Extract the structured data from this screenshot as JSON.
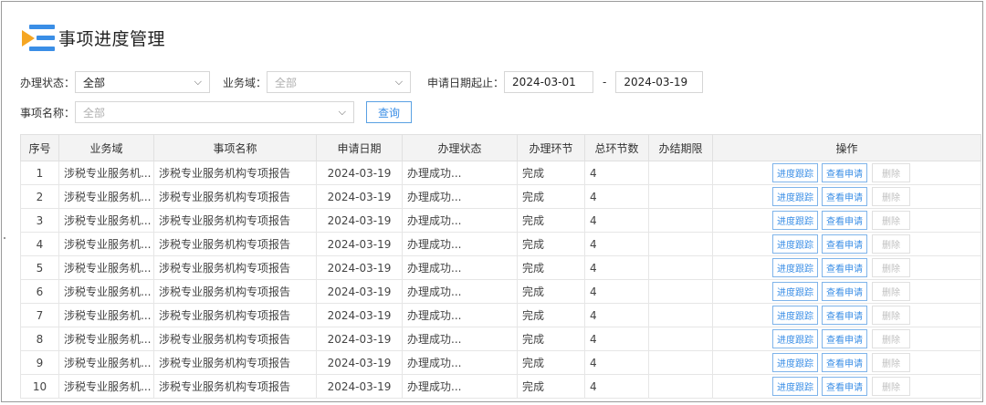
{
  "header": {
    "title": "事项进度管理"
  },
  "filters": {
    "status_label": "办理状态：",
    "status_value": "全部",
    "domain_label": "业务域：",
    "domain_placeholder": "全部",
    "date_label": "申请日期起止：",
    "date_start": "2024-03-01",
    "date_sep": "-",
    "date_end": "2024-03-19",
    "item_label": "事项名称：",
    "item_placeholder": "全部",
    "query_button": "查询"
  },
  "table": {
    "headers": [
      "序号",
      "业务域",
      "事项名称",
      "申请日期",
      "办理状态",
      "办理环节",
      "总环节数",
      "办结期限",
      "操作"
    ],
    "op_labels": {
      "track": "进度跟踪",
      "view": "查看申请",
      "delete": "删除"
    },
    "rows": [
      {
        "no": "1",
        "domain": "涉税专业服务机...",
        "name": "涉税专业服务机构专项报告",
        "date": "2024-03-19",
        "status": "办理成功...",
        "step": "完成",
        "total": "4",
        "deadline": ""
      },
      {
        "no": "2",
        "domain": "涉税专业服务机...",
        "name": "涉税专业服务机构专项报告",
        "date": "2024-03-19",
        "status": "办理成功...",
        "step": "完成",
        "total": "4",
        "deadline": ""
      },
      {
        "no": "3",
        "domain": "涉税专业服务机...",
        "name": "涉税专业服务机构专项报告",
        "date": "2024-03-19",
        "status": "办理成功...",
        "step": "完成",
        "total": "4",
        "deadline": ""
      },
      {
        "no": "4",
        "domain": "涉税专业服务机...",
        "name": "涉税专业服务机构专项报告",
        "date": "2024-03-19",
        "status": "办理成功...",
        "step": "完成",
        "total": "4",
        "deadline": ""
      },
      {
        "no": "5",
        "domain": "涉税专业服务机...",
        "name": "涉税专业服务机构专项报告",
        "date": "2024-03-19",
        "status": "办理成功...",
        "step": "完成",
        "total": "4",
        "deadline": ""
      },
      {
        "no": "6",
        "domain": "涉税专业服务机...",
        "name": "涉税专业服务机构专项报告",
        "date": "2024-03-19",
        "status": "办理成功...",
        "step": "完成",
        "total": "4",
        "deadline": ""
      },
      {
        "no": "7",
        "domain": "涉税专业服务机...",
        "name": "涉税专业服务机构专项报告",
        "date": "2024-03-19",
        "status": "办理成功...",
        "step": "完成",
        "total": "4",
        "deadline": ""
      },
      {
        "no": "8",
        "domain": "涉税专业服务机...",
        "name": "涉税专业服务机构专项报告",
        "date": "2024-03-19",
        "status": "办理成功...",
        "step": "完成",
        "total": "4",
        "deadline": ""
      },
      {
        "no": "9",
        "domain": "涉税专业服务机...",
        "name": "涉税专业服务机构专项报告",
        "date": "2024-03-19",
        "status": "办理成功...",
        "step": "完成",
        "total": "4",
        "deadline": ""
      },
      {
        "no": "10",
        "domain": "涉税专业服务机...",
        "name": "涉税专业服务机构专项报告",
        "date": "2024-03-19",
        "status": "办理成功...",
        "step": "完成",
        "total": "4",
        "deadline": ""
      }
    ]
  },
  "icons": {
    "logo": "list-menu-icon",
    "dropdown": "chevron-down-icon"
  },
  "colors": {
    "accent": "#3a8ee6",
    "logo_orange": "#f5a623",
    "header_bg": "#f3f3f3"
  }
}
